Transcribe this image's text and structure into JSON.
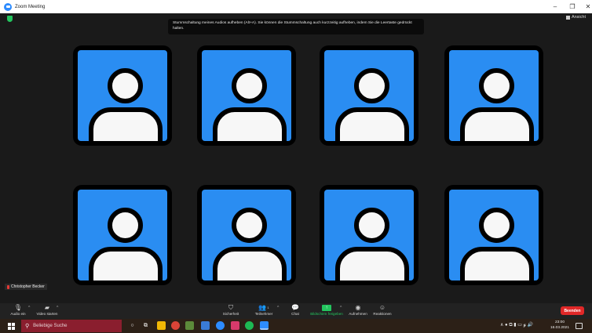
{
  "window": {
    "title": "Zoom Meeting",
    "controls": {
      "minimize": "–",
      "maximize": "❐",
      "close": "✕"
    }
  },
  "meeting": {
    "view_label": "Ansicht",
    "tooltip": "Stummschaltung meines Audios aufheben (Alt+A). Sie können die Stummschaltung auch kurzzeitig aufheben, indem Sie die Leertaste gedrückt halten.",
    "participant_name": "Christopher Becker",
    "tile_color": "#2a8df2",
    "tiles": 8
  },
  "toolbar": {
    "audio_label": "Audio ein",
    "video_label": "Video starten",
    "security_label": "Sicherheit",
    "participants_label": "Teilnehmer",
    "participants_count": "1",
    "chat_label": "Chat",
    "share_label": "Bildschirm freigeben",
    "record_label": "Aufnehmen",
    "reactions_label": "Reaktionen",
    "end_label": "Beenden",
    "share_color": "#23c55e",
    "end_color": "#e02828"
  },
  "taskbar": {
    "search_placeholder": "Beliebige Suche",
    "time": "23:00",
    "date": "16.03.2021",
    "tray_symbols": "∧ ● ⧉ ▮ ▭ ℊ 🔊"
  }
}
